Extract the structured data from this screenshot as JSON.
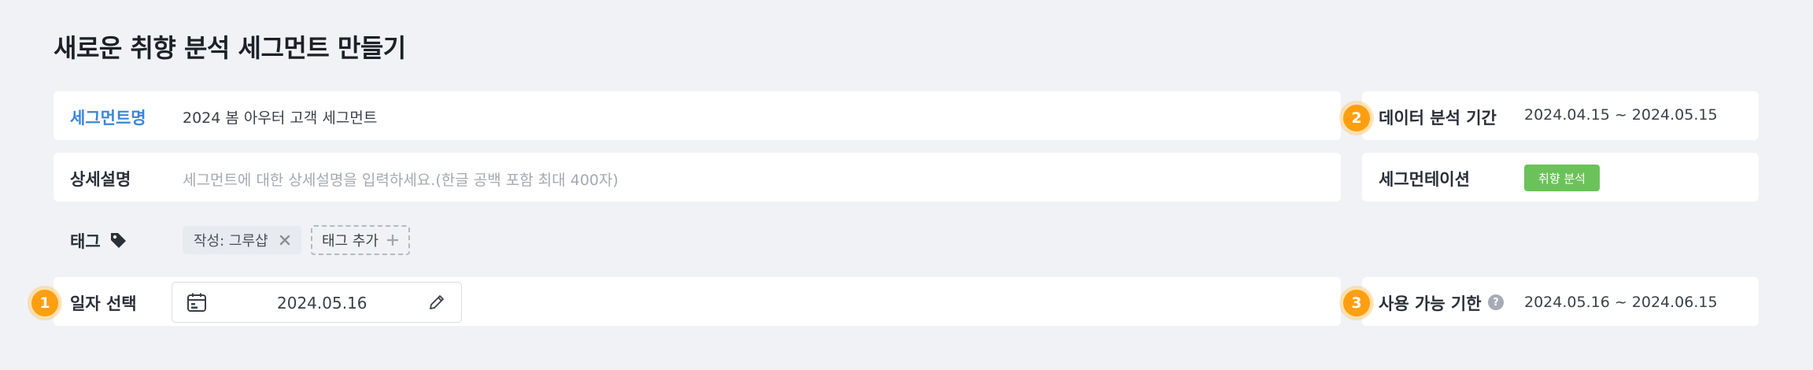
{
  "page": {
    "title": "새로운 취향 분석 세그먼트 만들기"
  },
  "colors": {
    "accent_blue": "#3a86d8",
    "step_badge": "#ff9f10",
    "pref_green": "#6bc25a"
  },
  "segment_name": {
    "label": "세그먼트명",
    "value": "2024 봄 아우터 고객 세그먼트"
  },
  "description": {
    "label": "상세설명",
    "placeholder": "세그먼트에 대한 상세설명을 입력하세요.(한글 공백 포함 최대 400자)"
  },
  "tags": {
    "label": "태그",
    "icon": "tag-icon",
    "chips": [
      {
        "text": "작성: 그루샵",
        "remove_icon": "close-icon"
      }
    ],
    "add_label": "태그 추가",
    "add_icon": "plus-icon"
  },
  "date_select": {
    "step": "1",
    "label": "일자 선택",
    "calendar_icon": "calendar-icon",
    "value": "2024.05.16",
    "edit_icon": "pencil-icon"
  },
  "analysis_period": {
    "step": "2",
    "label": "데이터 분석 기간",
    "value": "2024.04.15 ~ 2024.05.15"
  },
  "segmentation": {
    "label": "세그먼테이션",
    "badge": "취향 분석"
  },
  "availability": {
    "step": "3",
    "label": "사용 가능 기한",
    "help_icon": "question-icon",
    "help_glyph": "?",
    "value": "2024.05.16 ~ 2024.06.15"
  }
}
